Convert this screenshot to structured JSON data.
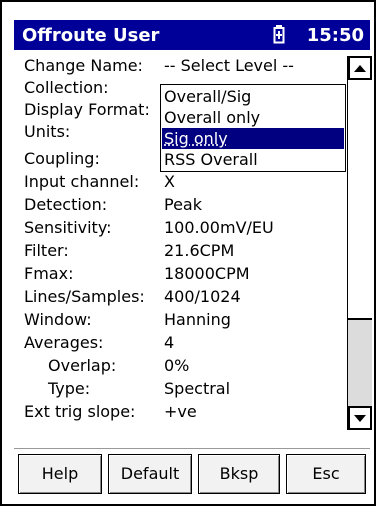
{
  "titlebar": {
    "title": "Offroute User",
    "time": "15:50",
    "battery_icon": "battery-icon"
  },
  "fields": [
    {
      "label": "Change Name:",
      "value": "-- Select Level --"
    },
    {
      "label": "Collection:",
      "value": ""
    },
    {
      "label": "Display Format:",
      "value": ""
    },
    {
      "label": "Units:",
      "value": ""
    },
    {
      "label": "Coupling:",
      "value": ""
    },
    {
      "label": "Input channel:",
      "value": "X"
    },
    {
      "label": "Detection:",
      "value": "Peak"
    },
    {
      "label": "Sensitivity:",
      "value": "100.00mV/EU"
    },
    {
      "label": "Filter:",
      "value": "21.6CPM"
    },
    {
      "label": "Fmax:",
      "value": "18000CPM"
    },
    {
      "label": "Lines/Samples:",
      "value": "400/1024"
    },
    {
      "label": "Window:",
      "value": "Hanning"
    },
    {
      "label": "Averages:",
      "value": "4"
    },
    {
      "label": "Overlap:",
      "value": "0%"
    },
    {
      "label": "Type:",
      "value": "Spectral"
    },
    {
      "label": "Ext trig slope:",
      "value": "+ve"
    }
  ],
  "dropdown": {
    "options": [
      "Overall/Sig",
      "Overall only",
      "Sig only",
      "RSS Overall"
    ],
    "selected": "Sig only"
  },
  "softkeys": [
    "Help",
    "Default",
    "Bksp",
    "Esc"
  ],
  "colors": {
    "titlebar_bg": "#000099",
    "selection_bg": "#000080"
  }
}
